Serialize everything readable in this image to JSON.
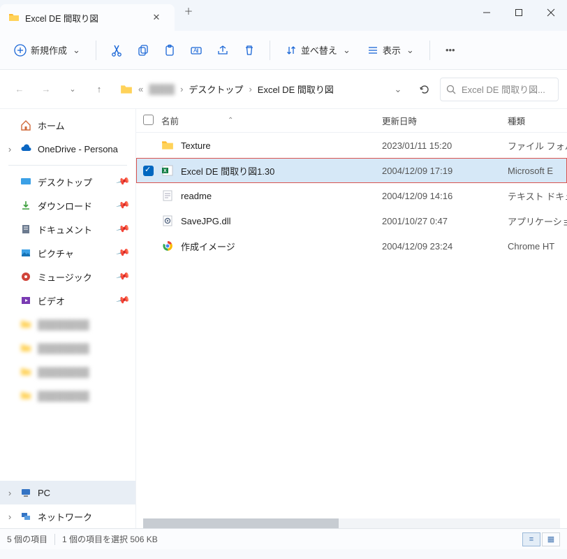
{
  "tab": {
    "title": "Excel DE 間取り図"
  },
  "toolbar": {
    "new_label": "新規作成",
    "sort_label": "並べ替え",
    "view_label": "表示"
  },
  "breadcrumb": {
    "items": [
      "デスクトップ",
      "Excel DE 間取り図"
    ]
  },
  "search": {
    "placeholder": "Excel DE 間取り図..."
  },
  "sidebar": {
    "home": "ホーム",
    "onedrive": "OneDrive - Persona",
    "desktop": "デスクトップ",
    "downloads": "ダウンロード",
    "documents": "ドキュメント",
    "pictures": "ピクチャ",
    "music": "ミュージック",
    "videos": "ビデオ",
    "pc": "PC",
    "network": "ネットワーク"
  },
  "columns": {
    "name": "名前",
    "date": "更新日時",
    "type": "種類"
  },
  "files": [
    {
      "name": "Texture",
      "date": "2023/01/11 15:20",
      "type": "ファイル フォル",
      "icon": "folder",
      "selected": false
    },
    {
      "name": "Excel DE 間取り図1.30",
      "date": "2004/12/09 17:19",
      "type": "Microsoft E",
      "icon": "excel",
      "selected": true
    },
    {
      "name": "readme",
      "date": "2004/12/09 14:16",
      "type": "テキスト ドキュ",
      "icon": "text",
      "selected": false
    },
    {
      "name": "SaveJPG.dll",
      "date": "2001/10/27 0:47",
      "type": "アプリケーショ",
      "icon": "dll",
      "selected": false
    },
    {
      "name": "作成イメージ",
      "date": "2004/12/09 23:24",
      "type": "Chrome HT",
      "icon": "chrome",
      "selected": false
    }
  ],
  "status": {
    "count": "5 個の項目",
    "selected": "1 個の項目を選択 506 KB"
  }
}
